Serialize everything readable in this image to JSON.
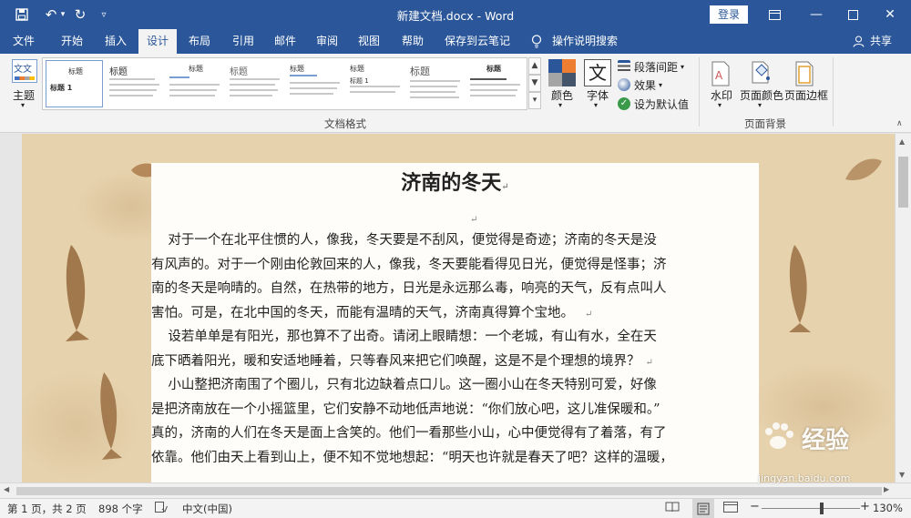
{
  "window": {
    "title": "新建文档.docx - Word",
    "login": "登录"
  },
  "tabs": [
    {
      "label": "文件"
    },
    {
      "label": "开始"
    },
    {
      "label": "插入"
    },
    {
      "label": "设计"
    },
    {
      "label": "布局"
    },
    {
      "label": "引用"
    },
    {
      "label": "邮件"
    },
    {
      "label": "审阅"
    },
    {
      "label": "视图"
    },
    {
      "label": "帮助"
    },
    {
      "label": "保存到云笔记"
    }
  ],
  "tell_me": "操作说明搜索",
  "share": "共享",
  "ribbon": {
    "theme_label": "主题",
    "theme_icon_text": "文文",
    "gallery_label": "文档格式",
    "thumb_head": "标题",
    "thumb_head_1": "标题 1",
    "colors_label": "颜色",
    "fonts_label": "字体",
    "fonts_icon_text": "文",
    "para_spacing": "段落间距",
    "effects": "效果",
    "set_default": "设为默认值",
    "watermark": "水印",
    "page_color": "页面颜色",
    "page_border": "页面边框",
    "page_bg_label": "页面背景"
  },
  "document": {
    "title": "济南的冬天",
    "paragraphs": [
      "    对于一个在北平住惯的人，像我，冬天要是不刮风，便觉得是奇迹；济南的冬天是没",
      "有风声的。对于一个刚由伦敦回来的人，像我，冬天要能看得见日光，便觉得是怪事；济",
      "南的冬天是响晴的。自然，在热带的地方，日光是永远那么毒，响亮的天气，反有点叫人",
      "害怕。可是，在北中国的冬天，而能有温晴的天气，济南真得算个宝地。",
      "    设若单单是有阳光，那也算不了出奇。请闭上眼睛想：一个老城，有山有水，全在天",
      "底下晒着阳光，暖和安适地睡着，只等春风来把它们唤醒，这是不是个理想的境界？",
      "    小山整把济南围了个圈儿，只有北边缺着点口儿。这一圈小山在冬天特别可爱，好像",
      "是把济南放在一个小摇篮里，它们安静不动地低声地说：“你们放心吧，这儿准保暖和。”",
      "真的，济南的人们在冬天是面上含笑的。他们一看那些小山，心中便觉得有了着落，有了",
      "依靠。他们由天上看到山上，便不知不觉地想起：“明天也许就是春天了吧？这样的温暖，"
    ],
    "para_mark": "↵"
  },
  "status": {
    "page": "第 1 页，共 2 页",
    "words": "898 个字",
    "lang": "中文(中国)",
    "zoom": "130%",
    "zoom_level": 0.62
  },
  "watermark_text": "经验",
  "watermark_sub": "jingyan.baidu.com",
  "colors": {
    "accent": "#2b579a",
    "ribbon": "#f3f3f3",
    "canvas": "#e6d2ad"
  }
}
